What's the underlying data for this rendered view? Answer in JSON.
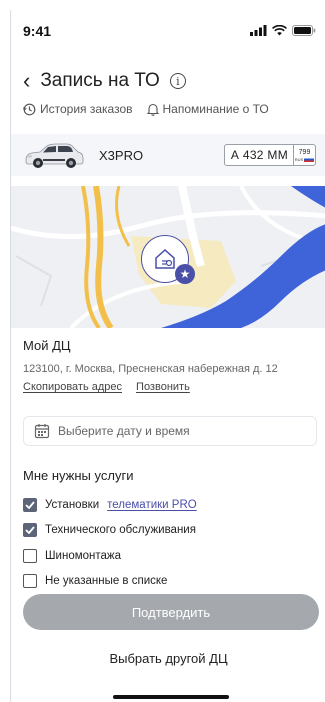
{
  "status_bar": {
    "time": "9:41"
  },
  "header": {
    "title": "Запись на ТО"
  },
  "links": {
    "history": "История заказов",
    "reminder": "Напоминание о ТО"
  },
  "car": {
    "name": "X3PRO",
    "plate_number": "А 432 ММ",
    "plate_region": "799",
    "plate_country": "RUS"
  },
  "dealer": {
    "name": "Мой ДЦ",
    "address": "123100, г. Москва, Пресненская набережная д. 12",
    "copy_address": "Скопировать адрес",
    "call": "Позвонить"
  },
  "date_picker": {
    "placeholder": "Выберите дату и время"
  },
  "services": {
    "title": "Мне нужны услуги",
    "items": [
      {
        "prefix": "Установки",
        "highlight": "телематики PRO",
        "checked": true
      },
      {
        "prefix": "Технического обслуживания",
        "highlight": "",
        "checked": true
      },
      {
        "prefix": "Шиномонтажа",
        "highlight": "",
        "checked": false
      },
      {
        "prefix": "Не указанные в списке",
        "highlight": "",
        "checked": false
      }
    ]
  },
  "actions": {
    "confirm": "Подтвердить",
    "choose_other": "Выбрать другой ДЦ"
  },
  "colors": {
    "accent": "#4a4fa7",
    "button_disabled": "#a5a9ae",
    "map_water": "#3f63d8",
    "map_road": "#f2c04a"
  }
}
